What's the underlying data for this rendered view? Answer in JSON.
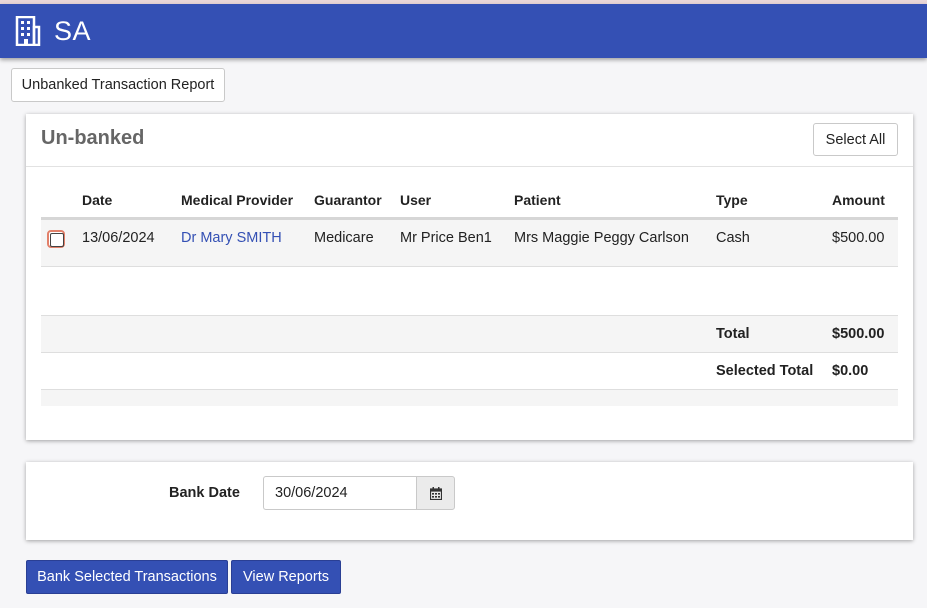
{
  "app": {
    "title": "SA",
    "icon": "building-icon"
  },
  "toolbar": {
    "report_button": "Unbanked Transaction Report"
  },
  "unbanked": {
    "title": "Un-banked",
    "select_all": "Select All",
    "columns": [
      "Date",
      "Medical Provider",
      "Guarantor",
      "User",
      "Patient",
      "Type",
      "Amount"
    ],
    "rows": [
      {
        "date": "13/06/2024",
        "provider": "Dr Mary SMITH",
        "guarantor": "Medicare",
        "user": "Mr Price Ben1",
        "patient": "Mrs Maggie Peggy Carlson",
        "type": "Cash",
        "amount": "$500.00"
      }
    ],
    "total_label": "Total",
    "total_value": "$500.00",
    "selected_total_label": "Selected Total",
    "selected_total_value": "$0.00"
  },
  "bank": {
    "label": "Bank Date",
    "date_value": "30/06/2024",
    "calendar_icon": "calendar-icon"
  },
  "actions": {
    "bank_selected": "Bank Selected Transactions",
    "view_reports": "View Reports"
  },
  "colors": {
    "primary": "#3450b4",
    "checkbox_focus": "#e2806a"
  }
}
